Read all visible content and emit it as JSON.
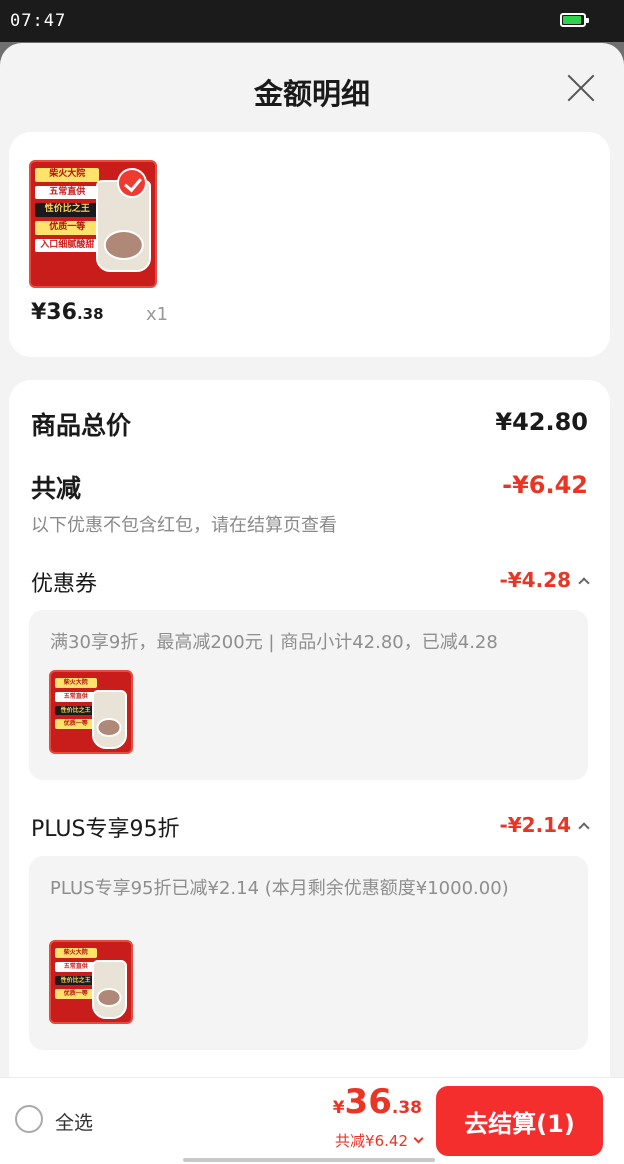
{
  "status_bar": {
    "time": "07:47",
    "battery_level": 0.9
  },
  "sheet": {
    "title": "金额明细",
    "close_icon": "close-icon"
  },
  "product": {
    "price_main": "¥36",
    "price_decimal": ".38",
    "quantity": "x1",
    "thumb_lines": [
      "柴火大院",
      "五常直供",
      "性价比之王",
      "优质一等",
      "入口细腻酸甜"
    ],
    "check_icon": "check-icon",
    "colors": {
      "thumb_bg": "#c81d1b",
      "badge": "#ef3a31"
    }
  },
  "detail": {
    "total_label": "商品总价",
    "total_value": "¥42.80",
    "reduce_label": "共减",
    "reduce_value": "-¥6.42",
    "reduce_note": "以下优惠不包含红包，请在结算页查看",
    "coupon": {
      "label": "优惠券",
      "value": "-¥4.28",
      "detail": "满30享9折，最高减200元 | 商品小计42.80，已减4.28",
      "toggle_icon": "chevron-up-icon"
    },
    "plus": {
      "label": "PLUS专享95折",
      "value": "-¥2.14",
      "detail": "PLUS专享95折已减¥2.14 (本月剩余优惠额度¥1000.00)",
      "toggle_icon": "chevron-up-icon"
    }
  },
  "bottom": {
    "select_all_label": "全选",
    "select_all_checked": false,
    "price_symbol": "¥",
    "price_main": "36",
    "price_decimal": ".38",
    "reduce_text": "共减¥6.42",
    "checkout_label": "去结算(1)",
    "colors": {
      "accent": "#ea3524",
      "checkout": "#f42d2d"
    }
  }
}
